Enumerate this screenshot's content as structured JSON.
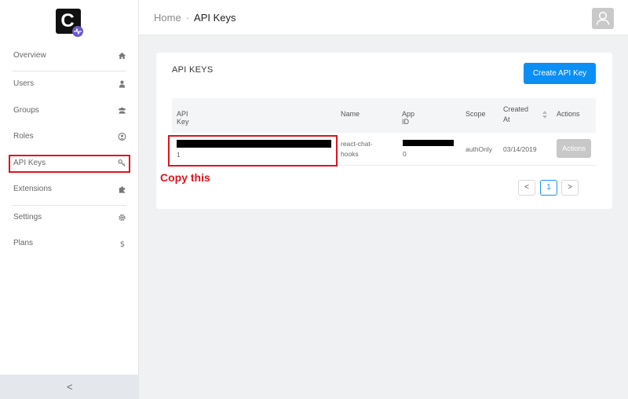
{
  "logo": {
    "letter": "C"
  },
  "sidebar": {
    "items": [
      {
        "label": "Overview",
        "icon": "home-icon"
      },
      {
        "label": "Users",
        "icon": "user-icon"
      },
      {
        "label": "Groups",
        "icon": "users-icon"
      },
      {
        "label": "Roles",
        "icon": "user-circle-icon"
      },
      {
        "label": "API Keys",
        "icon": "key-icon"
      },
      {
        "label": "Extensions",
        "icon": "puzzle-icon"
      },
      {
        "label": "Settings",
        "icon": "gear-icon"
      },
      {
        "label": "Plans",
        "icon": "dollar-icon"
      }
    ],
    "collapse": "<"
  },
  "header": {
    "home": "Home",
    "separator": "·",
    "current": "API Keys"
  },
  "card": {
    "title": "API KEYS",
    "create_button": "Create API Key",
    "columns": [
      "API Key",
      "Name",
      "App ID",
      "Scope",
      "Created",
      "At",
      "Actions"
    ],
    "row": {
      "api_key_tail": "1",
      "name_line1": "react-chat-",
      "name_line2": "hooks",
      "app_id_tail": "0",
      "scope": "authOnly",
      "created_at": "03/14/2019",
      "actions": "Actions"
    }
  },
  "annotation": {
    "label": "Copy this"
  },
  "pagination": {
    "prev": "<",
    "page": "1",
    "next": ">"
  },
  "colors": {
    "accent": "#0b8ff5",
    "annotation": "#e0141e"
  }
}
